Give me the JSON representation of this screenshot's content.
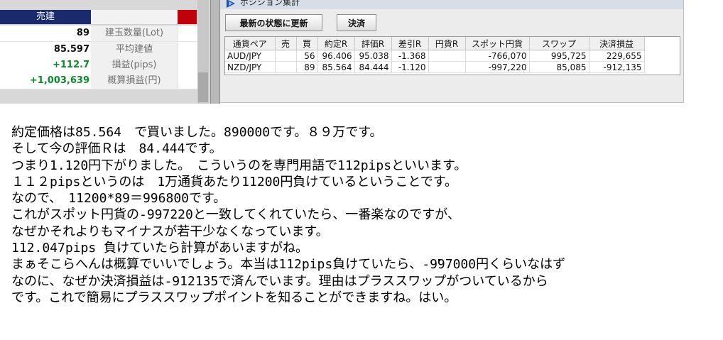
{
  "left_panel": {
    "header_label": "売建",
    "rows": [
      {
        "value": "89",
        "label": "建玉数量(Lot)",
        "positive": false
      },
      {
        "value": "85.597",
        "label": "平均建値",
        "positive": false
      },
      {
        "value": "+112.7",
        "label": "損益(pips)",
        "positive": true
      },
      {
        "value": "+1,003,639",
        "label": "概算損益(円)",
        "positive": true
      }
    ]
  },
  "window": {
    "title": "ポジション集計",
    "update_button": "最新の状態に更新",
    "settle_button": "決済",
    "columns": [
      "通貨ペア",
      "売",
      "買",
      "約定R",
      "評価R",
      "差引R",
      "円貨R",
      "スポット円貨",
      "スワップ",
      "決済損益"
    ],
    "rows": [
      [
        "AUD/JPY",
        "",
        "56",
        "96.406",
        "95.038",
        "-1.368",
        "",
        "-766,070",
        "995,725",
        "229,655"
      ],
      [
        "NZD/JPY",
        "",
        "89",
        "85.564",
        "84.444",
        "-1.120",
        "",
        "-997,220",
        "85,085",
        "-912,135"
      ]
    ]
  },
  "explanation": [
    "約定価格は85.564　で買いました。890000です。８９万です。",
    "そして今の評価Ｒは　84.444です。",
    "つまり1.120円下がりました。　こういうのを専門用語で112pipsといいます。",
    "１１２pipsというのは　1万通貨あたり11200円負けているということです。",
    "なので、　11200*89＝996800です。",
    "これがスポット円貨の-997220と一致してくれていたら、一番楽なのですが、",
    "なぜかそれよりもマイナスが若干少なくなっています。",
    "112.047pips 負けていたら計算があいますがね。",
    "まぁそこらへんは概算でいいでしょう。本当は112pips負けていたら、-997000円くらいなはず",
    "なのに、なぜか決済損益は-912135で済んでいます。理由はプラススワップがついているから",
    "です。これで簡易にプラススワップポイントを知ることができますね。はい。"
  ],
  "colors": {
    "header_navy": "#1a2a6c",
    "positive_green": "#0a8a2a",
    "accent_red": "#c0000a"
  },
  "icons": {
    "app": "app-logo-icon"
  }
}
